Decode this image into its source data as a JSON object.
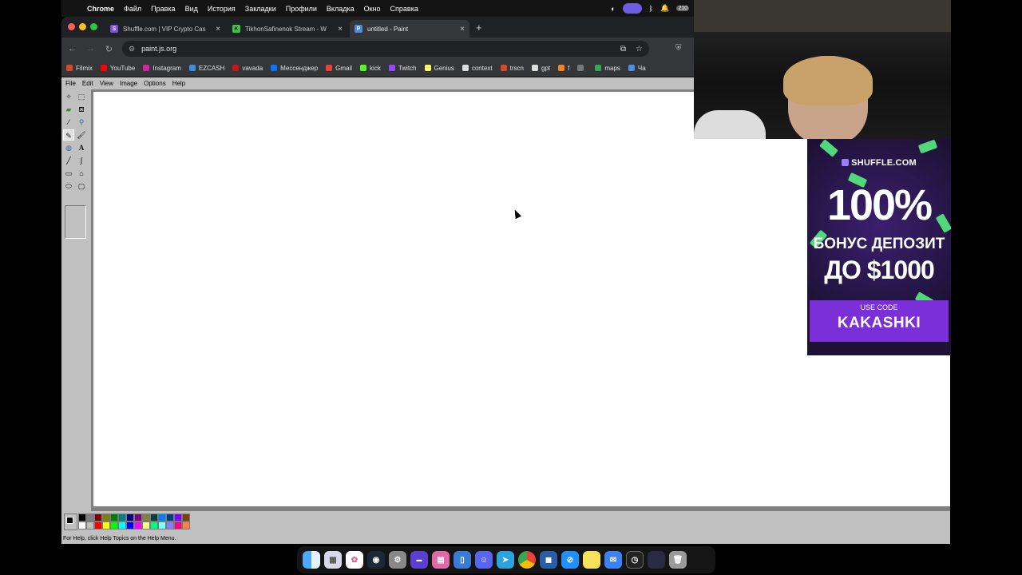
{
  "menubar": {
    "app": "Chrome",
    "items": [
      "Файл",
      "Правка",
      "Вид",
      "История",
      "Закладки",
      "Профили",
      "Вкладка",
      "Окно",
      "Справка"
    ],
    "notification_count": "210"
  },
  "browser": {
    "tabs": [
      {
        "title": "Shuffle.com | VIP Crypto Cas",
        "color": "#7b4fe0",
        "glyph": "S"
      },
      {
        "title": "TikhonSafinenok Stream - W",
        "color": "#2ecc40",
        "glyph": "K"
      },
      {
        "title": "untitled - Paint",
        "color": "#4c8bd8",
        "glyph": "P"
      }
    ],
    "active_tab": 2,
    "url": "paint.js.org",
    "bookmarks": [
      {
        "label": "Filmix",
        "color": "#d9472b"
      },
      {
        "label": "YouTube",
        "color": "#ff0000"
      },
      {
        "label": "Instagram",
        "color": "#d6249f"
      },
      {
        "label": "EZCASH",
        "color": "#3b8de0"
      },
      {
        "label": "vavada",
        "color": "#c4161c"
      },
      {
        "label": "Мессенджер",
        "color": "#0077ff"
      },
      {
        "label": "Gmail",
        "color": "#ea4335"
      },
      {
        "label": "kick",
        "color": "#53fc18"
      },
      {
        "label": "Twitch",
        "color": "#9146ff"
      },
      {
        "label": "Genius",
        "color": "#ffff64"
      },
      {
        "label": "context",
        "color": "#dddddd"
      },
      {
        "label": "trscn",
        "color": "#d9472b"
      },
      {
        "label": "gpt",
        "color": "#dddddd"
      },
      {
        "label": "f",
        "color": "#f58220"
      },
      {
        "label": "",
        "color": "#777777"
      },
      {
        "label": "maps",
        "color": "#34a853"
      },
      {
        "label": "Ча",
        "color": "#4a90e2"
      }
    ]
  },
  "paint": {
    "menu": [
      "File",
      "Edit",
      "View",
      "Image",
      "Options",
      "Help"
    ],
    "status": "For Help, click Help Topics on the Help Menu.",
    "palette": [
      "#000000",
      "#808080",
      "#800000",
      "#808000",
      "#008000",
      "#008080",
      "#000080",
      "#800080",
      "#808040",
      "#004040",
      "#0080ff",
      "#004080",
      "#8000ff",
      "#804000",
      "#ffffff",
      "#c0c0c0",
      "#ff0000",
      "#ffff00",
      "#00ff00",
      "#00ffff",
      "#0000ff",
      "#ff00ff",
      "#ffff80",
      "#00ff80",
      "#80ffff",
      "#8080ff",
      "#ff0080",
      "#ff8040"
    ]
  },
  "ad": {
    "brand": "SHUFFLE.COM",
    "headline": "100%",
    "line1": "БОНУС ДЕПОЗИТ",
    "line2": "ДО $1000",
    "use_code_label": "USE CODE",
    "code": "KAKASHKI"
  }
}
